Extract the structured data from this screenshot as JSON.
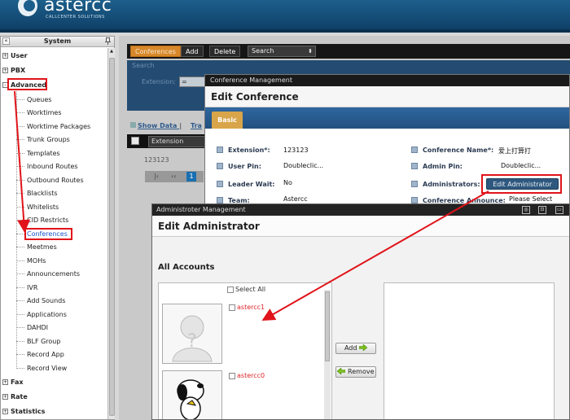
{
  "brand": {
    "name": "astercc",
    "tagline": "CALLCENTER SOLUTIONS"
  },
  "sidebar": {
    "title": "System",
    "collapse": "«",
    "sections": [
      {
        "label": "User",
        "toggle": "+"
      },
      {
        "label": "PBX",
        "toggle": "+"
      },
      {
        "label": "Advanced",
        "toggle": "-"
      },
      {
        "label": "Fax",
        "toggle": "+"
      },
      {
        "label": "Rate",
        "toggle": "+"
      },
      {
        "label": "Statistics",
        "toggle": "+"
      }
    ],
    "advanced_items": [
      "Queues",
      "Worktimes",
      "Worktime Packages",
      "Trunk Groups",
      "Templates",
      "Inbound Routes",
      "Outbound Routes",
      "Blacklists",
      "Whitelists",
      "CID Restricts",
      "Conferences",
      "Meetmes",
      "MOHs",
      "Announcements",
      "IVR",
      "Add Sounds",
      "Applications",
      "DAHDI",
      "BLF Group",
      "Record App",
      "Record View"
    ]
  },
  "toolbar": {
    "active_label": "Conferences",
    "add_label": "Add",
    "delete_label": "Delete",
    "search_label": "Search"
  },
  "search_panel": {
    "title": "Search",
    "field_label": "Extension:",
    "operator": "="
  },
  "grid": {
    "show_data": "Show Data",
    "separator": "|",
    "trash": "Tra",
    "column": "Extension",
    "row_value": "123123",
    "pager": {
      "first": "|‹",
      "prev": "‹‹",
      "page": "1"
    }
  },
  "conference_dialog": {
    "window_title": "Conference Management",
    "heading": "Edit Conference",
    "tab": "Basic",
    "fields": {
      "extension": {
        "label": "Extension*:",
        "value": "123123"
      },
      "conference_name": {
        "label": "Conference Name*:",
        "value": "爱上打算打"
      },
      "user_pin": {
        "label": "User Pin:",
        "value": "Doubleclic..."
      },
      "admin_pin": {
        "label": "Admin Pin:",
        "value": "Doubleclic..."
      },
      "leader_wait": {
        "label": "Leader Wait:",
        "value": "No"
      },
      "administrators": {
        "label": "Administrators:",
        "button": "Edit Administrator"
      },
      "team": {
        "label": "Team:",
        "value": "Astercc"
      },
      "conference_announce": {
        "label": "Conference Announce:",
        "value": "Please Select"
      }
    }
  },
  "admin_dialog": {
    "window_title": "Administroter Management",
    "controls": {
      "refresh": "◎",
      "maximize": "⊡",
      "close": "▭"
    },
    "heading": "Edit Administrator",
    "all_accounts_label": "All Accounts",
    "select_all": "Select All",
    "accounts": [
      {
        "name": "astercc1",
        "avatar": "placeholder-avatar"
      },
      {
        "name": "astercc0",
        "avatar": "snoopy-avatar"
      }
    ],
    "add_button": "Add",
    "remove_button": "Remove"
  },
  "colors": {
    "annotation_red": "#e0141a",
    "header_blue": "#1d5f8c",
    "tab_gold": "#d9a54a"
  }
}
